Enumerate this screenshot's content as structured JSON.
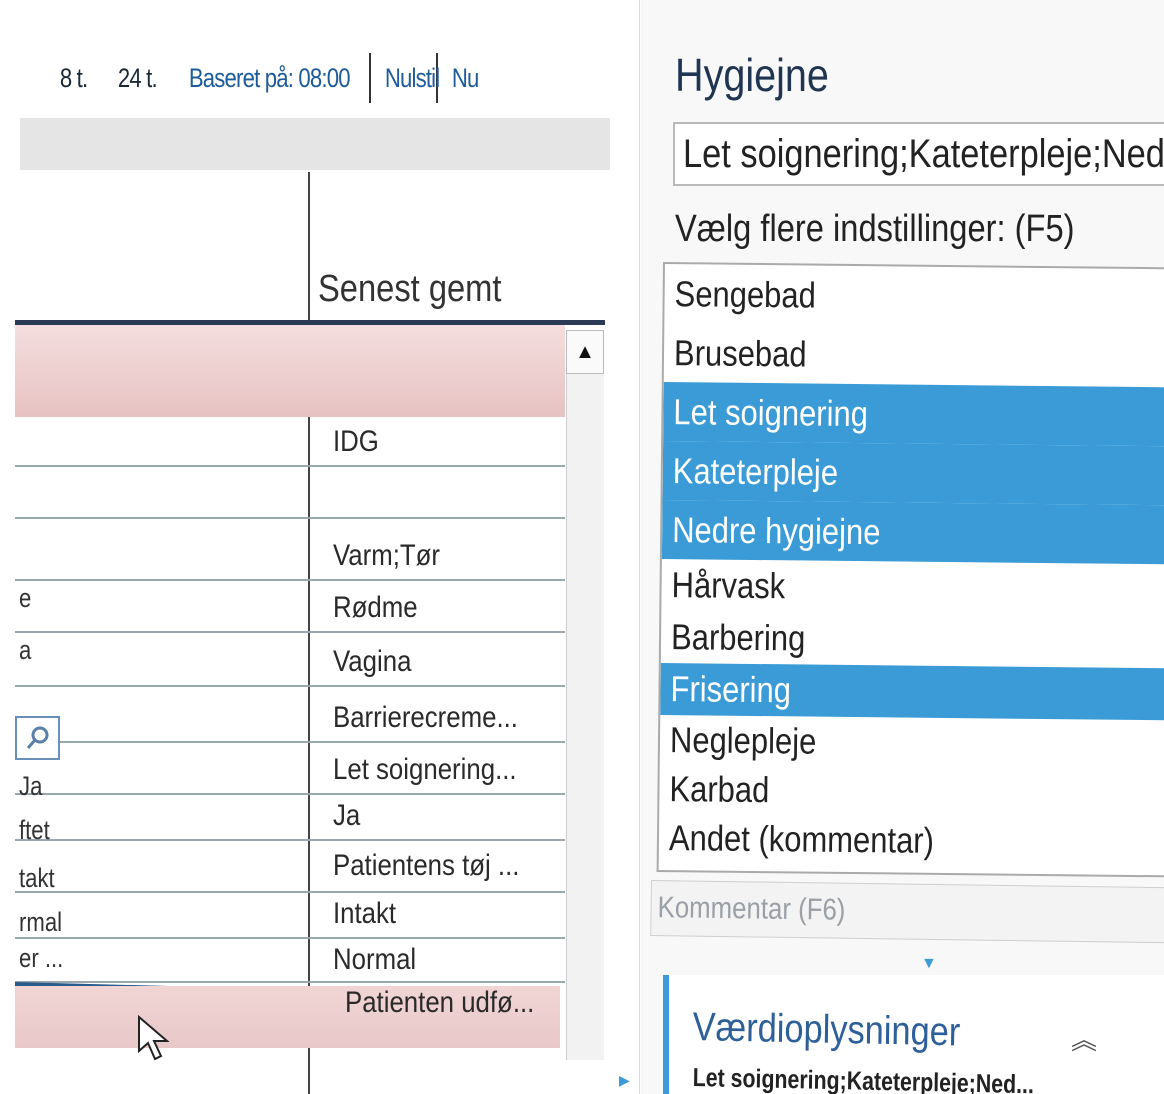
{
  "toolbar": {
    "eight_hours": "8 t.",
    "twentyfour_hours": "24 t.",
    "based_on": "Baseret på: 08:00",
    "reset": "Nulstil",
    "now": "Nu"
  },
  "table": {
    "column_header": "Senest gemt",
    "rows": [
      {
        "left": "",
        "value": ""
      },
      {
        "left": "",
        "value": "IDG"
      },
      {
        "left": "",
        "value": ""
      },
      {
        "left": "",
        "value": "Varm;Tør"
      },
      {
        "left": "e",
        "value": "Rødme"
      },
      {
        "left": "a",
        "value": "Vagina"
      },
      {
        "left": "",
        "value": "Barrierecreme..."
      },
      {
        "left": "Ja",
        "value": "Let soignering..."
      },
      {
        "left": "ftet",
        "value": "Ja"
      },
      {
        "left": "takt",
        "value": "Patientens tøj ..."
      },
      {
        "left": "rmal",
        "value": "Intakt"
      },
      {
        "left": "er ...",
        "value": "Normal"
      },
      {
        "left": "",
        "value": "Patienten udfø..."
      }
    ]
  },
  "hygiene": {
    "title": "Hygiejne",
    "current_value": "Let soignering;Kateterpleje;Ned",
    "multi_select_label": "Vælg flere indstillinger: (F5)",
    "options": [
      {
        "label": "Sengebad",
        "selected": false
      },
      {
        "label": "Brusebad",
        "selected": false
      },
      {
        "label": "Let soignering",
        "selected": true
      },
      {
        "label": "Kateterpleje",
        "selected": true
      },
      {
        "label": "Nedre hygiejne",
        "selected": true
      },
      {
        "label": "Hårvask",
        "selected": false
      },
      {
        "label": "Barbering",
        "selected": false
      },
      {
        "label": "Frisering",
        "selected": true
      },
      {
        "label": "Neglepleje",
        "selected": false
      },
      {
        "label": "Karbad",
        "selected": false
      },
      {
        "label": "Andet (kommentar)",
        "selected": false
      }
    ],
    "comment_placeholder": "Kommentar (F6)"
  },
  "value_info": {
    "title": "Værdioplysninger",
    "text": "Let soignering;Kateterpleje;Ned..."
  },
  "colors": {
    "selection": "#3a9bd6",
    "header_blue": "#1f3552",
    "link_blue": "#2d5f98"
  }
}
